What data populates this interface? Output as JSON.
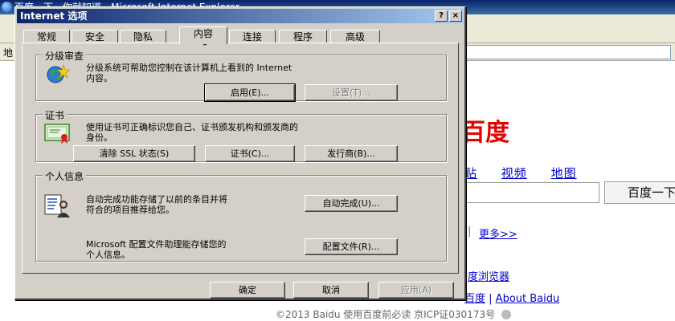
{
  "browser": {
    "title": "百度一下，你就知道 - Microsoft Internet Explorer",
    "address_label": "地"
  },
  "baidu": {
    "logo": "百度",
    "nav": [
      "贴",
      "视频",
      "地图"
    ],
    "search_button": "百度一下",
    "more_sep": "|",
    "more_link": "更多>>",
    "browser_link": "度浏览器",
    "about_prefix": "百度",
    "about_link": "About Baidu",
    "copyright": "©2013 Baidu 使用百度前必读 京ICP证030173号"
  },
  "dialog": {
    "title": "Internet 选项",
    "help_label": "?",
    "close_label": "×",
    "tabs": [
      {
        "label": "常规"
      },
      {
        "label": "安全"
      },
      {
        "label": "隐私"
      },
      {
        "label": "内容",
        "active": true
      },
      {
        "label": "连接"
      },
      {
        "label": "程序"
      },
      {
        "label": "高级"
      }
    ],
    "ratings": {
      "title": "分级审查",
      "description": "分级系统可帮助您控制在该计算机上看到的 Internet\n内容。",
      "icon": "globe-star-icon",
      "enable_button": "启用(E)...",
      "settings_button": "设置(T)..."
    },
    "certificates": {
      "title": "证书",
      "description": "使用证书可正确标识您自己、证书颁发机构和颁发商的\n身份。",
      "icon": "certificate-icon",
      "clear_ssl_button": "清除 SSL 状态(S)",
      "certificates_button": "证书(C)...",
      "publishers_button": "发行商(B)..."
    },
    "personal": {
      "title": "个人信息",
      "autocomplete_description": "自动完成功能存储了以前的条目并将\n符合的项目推荐给您。",
      "autocomplete_icon": "profile-form-icon",
      "autocomplete_button": "自动完成(U)...",
      "profile_description": "Microsoft 配置文件助理能存储您的\n个人信息。",
      "profile_button": "配置文件(R)..."
    },
    "ok_button": "确定",
    "cancel_button": "取消",
    "apply_button": "应用(A)"
  }
}
